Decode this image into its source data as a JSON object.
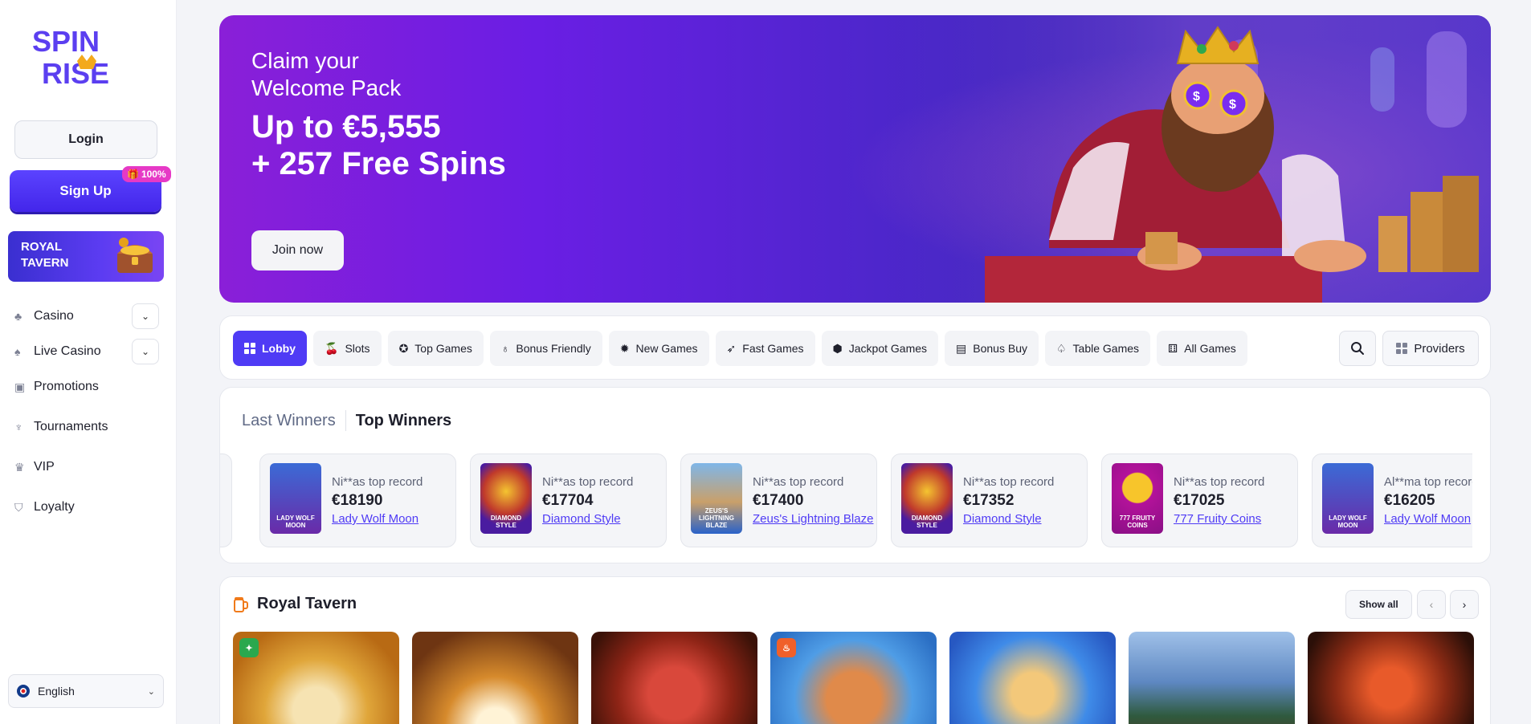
{
  "sidebar": {
    "logo_text": "SPIN RISE",
    "login_label": "Login",
    "signup_label": "Sign Up",
    "signup_badge": "100%",
    "promo_banner": "ROYAL TAVERN",
    "nav": [
      {
        "label": "Casino",
        "icon": "club-icon",
        "expandable": true
      },
      {
        "label": "Live Casino",
        "icon": "spade-icon",
        "expandable": true
      },
      {
        "label": "Promotions",
        "icon": "gift-icon",
        "expandable": false
      },
      {
        "label": "Tournaments",
        "icon": "trophy-icon",
        "expandable": false
      },
      {
        "label": "VIP",
        "icon": "crown-icon",
        "expandable": false
      },
      {
        "label": "Loyalty",
        "icon": "shield-icon",
        "expandable": false
      }
    ],
    "language": "English"
  },
  "hero": {
    "claim_line1": "Claim your",
    "claim_line2": "Welcome Pack",
    "offer_line1": "Up to €5,555",
    "offer_line2": "+ 257 Free Spins",
    "cta": "Join now"
  },
  "categories": [
    {
      "label": "Lobby",
      "active": true
    },
    {
      "label": "Slots",
      "active": false
    },
    {
      "label": "Top Games",
      "active": false
    },
    {
      "label": "Bonus Friendly",
      "active": false
    },
    {
      "label": "New Games",
      "active": false
    },
    {
      "label": "Fast Games",
      "active": false
    },
    {
      "label": "Jackpot Games",
      "active": false
    },
    {
      "label": "Bonus Buy",
      "active": false
    },
    {
      "label": "Table Games",
      "active": false
    },
    {
      "label": "All Games",
      "active": false
    }
  ],
  "providers_label": "Providers",
  "winners": {
    "tab_last": "Last Winners",
    "tab_top": "Top Winners",
    "items": [
      {
        "who": "Ni**as top record",
        "amount": "€18190",
        "game": "Lady Wolf Moon",
        "thumb_label": "LADY WOLF MOON"
      },
      {
        "who": "Ni**as top record",
        "amount": "€17704",
        "game": "Diamond Style",
        "thumb_label": "DIAMOND STYLE"
      },
      {
        "who": "Ni**as top record",
        "amount": "€17400",
        "game": "Zeus's Lightning Blaze",
        "thumb_label": "ZEUS'S LIGHTNING BLAZE"
      },
      {
        "who": "Ni**as top record",
        "amount": "€17352",
        "game": "Diamond Style",
        "thumb_label": "DIAMOND STYLE"
      },
      {
        "who": "Ni**as top record",
        "amount": "€17025",
        "game": "777 Fruity Coins",
        "thumb_label": "777 FRUITY COINS"
      },
      {
        "who": "Al**ma top record",
        "amount": "€16205",
        "game": "Lady Wolf Moon",
        "thumb_label": "LADY WOLF MOON"
      }
    ]
  },
  "tavern": {
    "title": "Royal Tavern",
    "show_all": "Show all"
  },
  "colors": {
    "accent": "#4f3bf5",
    "hero_start": "#8a1fd8",
    "hero_end": "#3b2ab0"
  }
}
